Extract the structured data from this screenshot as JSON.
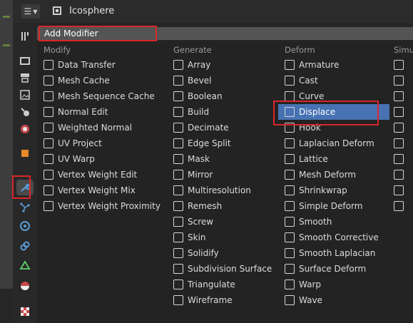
{
  "header": {
    "object_name": "Icosphere"
  },
  "add_modifier": {
    "label": "Add Modifier"
  },
  "columns": [
    {
      "title": "Modify",
      "items": [
        "Data Transfer",
        "Mesh Cache",
        "Mesh Sequence Cache",
        "Normal Edit",
        "Weighted Normal",
        "UV Project",
        "UV Warp",
        "Vertex Weight Edit",
        "Vertex Weight Mix",
        "Vertex Weight Proximity"
      ]
    },
    {
      "title": "Generate",
      "items": [
        "Array",
        "Bevel",
        "Boolean",
        "Build",
        "Decimate",
        "Edge Split",
        "Mask",
        "Mirror",
        "Multiresolution",
        "Remesh",
        "Screw",
        "Skin",
        "Solidify",
        "Subdivision Surface",
        "Triangulate",
        "Wireframe"
      ]
    },
    {
      "title": "Deform",
      "items": [
        "Armature",
        "Cast",
        "Curve",
        "Displace",
        "Hook",
        "Laplacian Deform",
        "Lattice",
        "Mesh Deform",
        "Shrinkwrap",
        "Simple Deform",
        "Smooth",
        "Smooth Corrective",
        "Smooth Laplacian",
        "Surface Deform",
        "Warp",
        "Wave"
      ]
    },
    {
      "title": "Simul"
    }
  ],
  "selected_item": "Displace",
  "colors": {
    "accent": "#4772b3",
    "highlight_box": "#d9262a"
  }
}
